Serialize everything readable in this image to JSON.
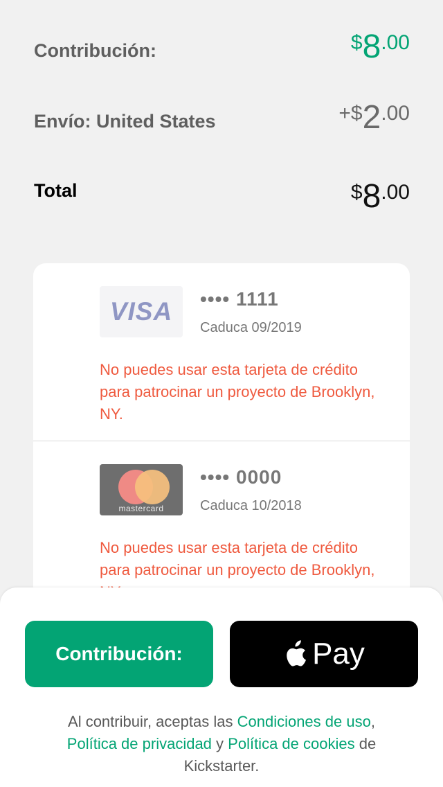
{
  "summary": {
    "pledge": {
      "label": "Contribución:",
      "symbol": "$",
      "whole": "8",
      "cents": ".00"
    },
    "shipping": {
      "label": "Envío: United States",
      "prefix": "+",
      "symbol": "$",
      "whole": "2",
      "cents": ".00"
    },
    "total": {
      "label": "Total",
      "symbol": "$",
      "whole": "8",
      "cents": ".00"
    }
  },
  "cards": [
    {
      "brand": "VISA",
      "number": "•••• 1111",
      "expiry": "Caduca 09/2019",
      "error": "No puedes usar esta tarjeta de crédito para patrocinar un proyecto de Brooklyn, NY."
    },
    {
      "brand": "mastercard",
      "number": "•••• 0000",
      "expiry": "Caduca 10/2018",
      "error": "No puedes usar esta tarjeta de crédito para patrocinar un proyecto de Brooklyn, NY."
    }
  ],
  "actions": {
    "pledge_label": "Contribución:",
    "apple_pay_label": "Pay"
  },
  "legal": {
    "prefix": "Al contribuir, aceptas las ",
    "terms": "Condiciones de uso",
    "sep1": ", ",
    "privacy": "Política de privacidad",
    "sep2": " y ",
    "cookies": "Política de cookies",
    "suffix": " de Kickstarter."
  },
  "colors": {
    "accent": "#03a474",
    "error": "#ef5a3f"
  },
  "icons": {
    "apple_pay": "apple-icon"
  }
}
